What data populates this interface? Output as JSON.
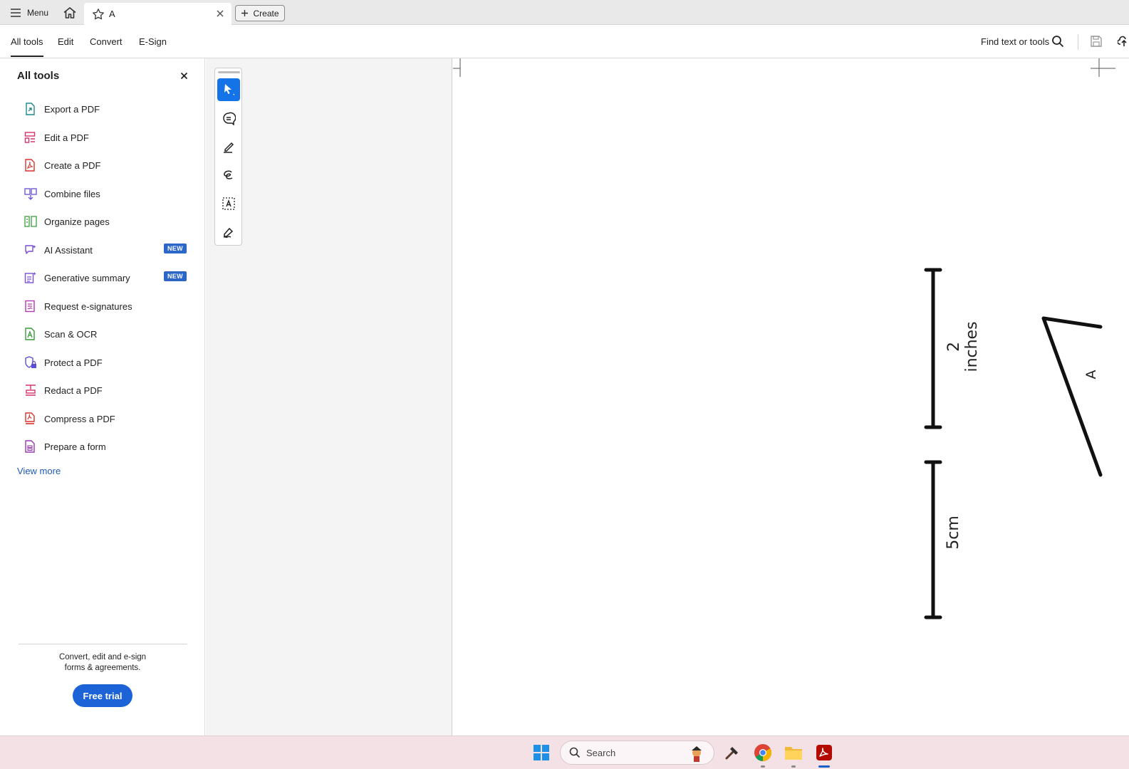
{
  "tabbar": {
    "menu_label": "Menu",
    "tab_title": "A",
    "create_label": "Create"
  },
  "topmenu": {
    "items": [
      "All tools",
      "Edit",
      "Convert",
      "E-Sign"
    ],
    "active": "All tools",
    "find_label": "Find text or tools"
  },
  "leftpanel": {
    "title": "All tools",
    "tools": [
      {
        "label": "Export a PDF",
        "icon": "export-pdf-icon",
        "color": "#1f8a8a"
      },
      {
        "label": "Edit a PDF",
        "icon": "edit-pdf-icon",
        "color": "#d6336c"
      },
      {
        "label": "Create a PDF",
        "icon": "create-pdf-icon",
        "color": "#d9342b"
      },
      {
        "label": "Combine files",
        "icon": "combine-files-icon",
        "color": "#6e5bd6"
      },
      {
        "label": "Organize pages",
        "icon": "organize-pages-icon",
        "color": "#4aa54a"
      },
      {
        "label": "AI Assistant",
        "icon": "ai-assistant-icon",
        "color": "#7a4fd6",
        "badge": "NEW"
      },
      {
        "label": "Generative summary",
        "icon": "generative-summary-icon",
        "color": "#7a4fd6",
        "badge": "NEW"
      },
      {
        "label": "Request e-signatures",
        "icon": "request-esignatures-icon",
        "color": "#b03ab0"
      },
      {
        "label": "Scan & OCR",
        "icon": "scan-ocr-icon",
        "color": "#3a9a3a"
      },
      {
        "label": "Protect a PDF",
        "icon": "protect-pdf-icon",
        "color": "#5b4fd6"
      },
      {
        "label": "Redact a PDF",
        "icon": "redact-pdf-icon",
        "color": "#d6336c"
      },
      {
        "label": "Compress a PDF",
        "icon": "compress-pdf-icon",
        "color": "#d9342b"
      },
      {
        "label": "Prepare a form",
        "icon": "prepare-form-icon",
        "color": "#9a3ab0"
      }
    ],
    "view_more": "View more",
    "promo_line1": "Convert, edit and e-sign",
    "promo_line2": "forms & agreements.",
    "trial_label": "Free trial"
  },
  "quicktools": [
    "select-icon",
    "comment-icon",
    "highlight-icon",
    "draw-icon",
    "text-select-icon",
    "sign-icon"
  ],
  "document": {
    "label_inches": "2 inches",
    "label_cm": "5cm",
    "label_a": "A"
  },
  "taskbar": {
    "search_placeholder": "Search"
  },
  "colors": {
    "accent": "#1473e6",
    "badge": "#2b66c8",
    "trial": "#1c63d8",
    "link": "#1e5bb8",
    "taskbar": "#f3e1e6"
  }
}
